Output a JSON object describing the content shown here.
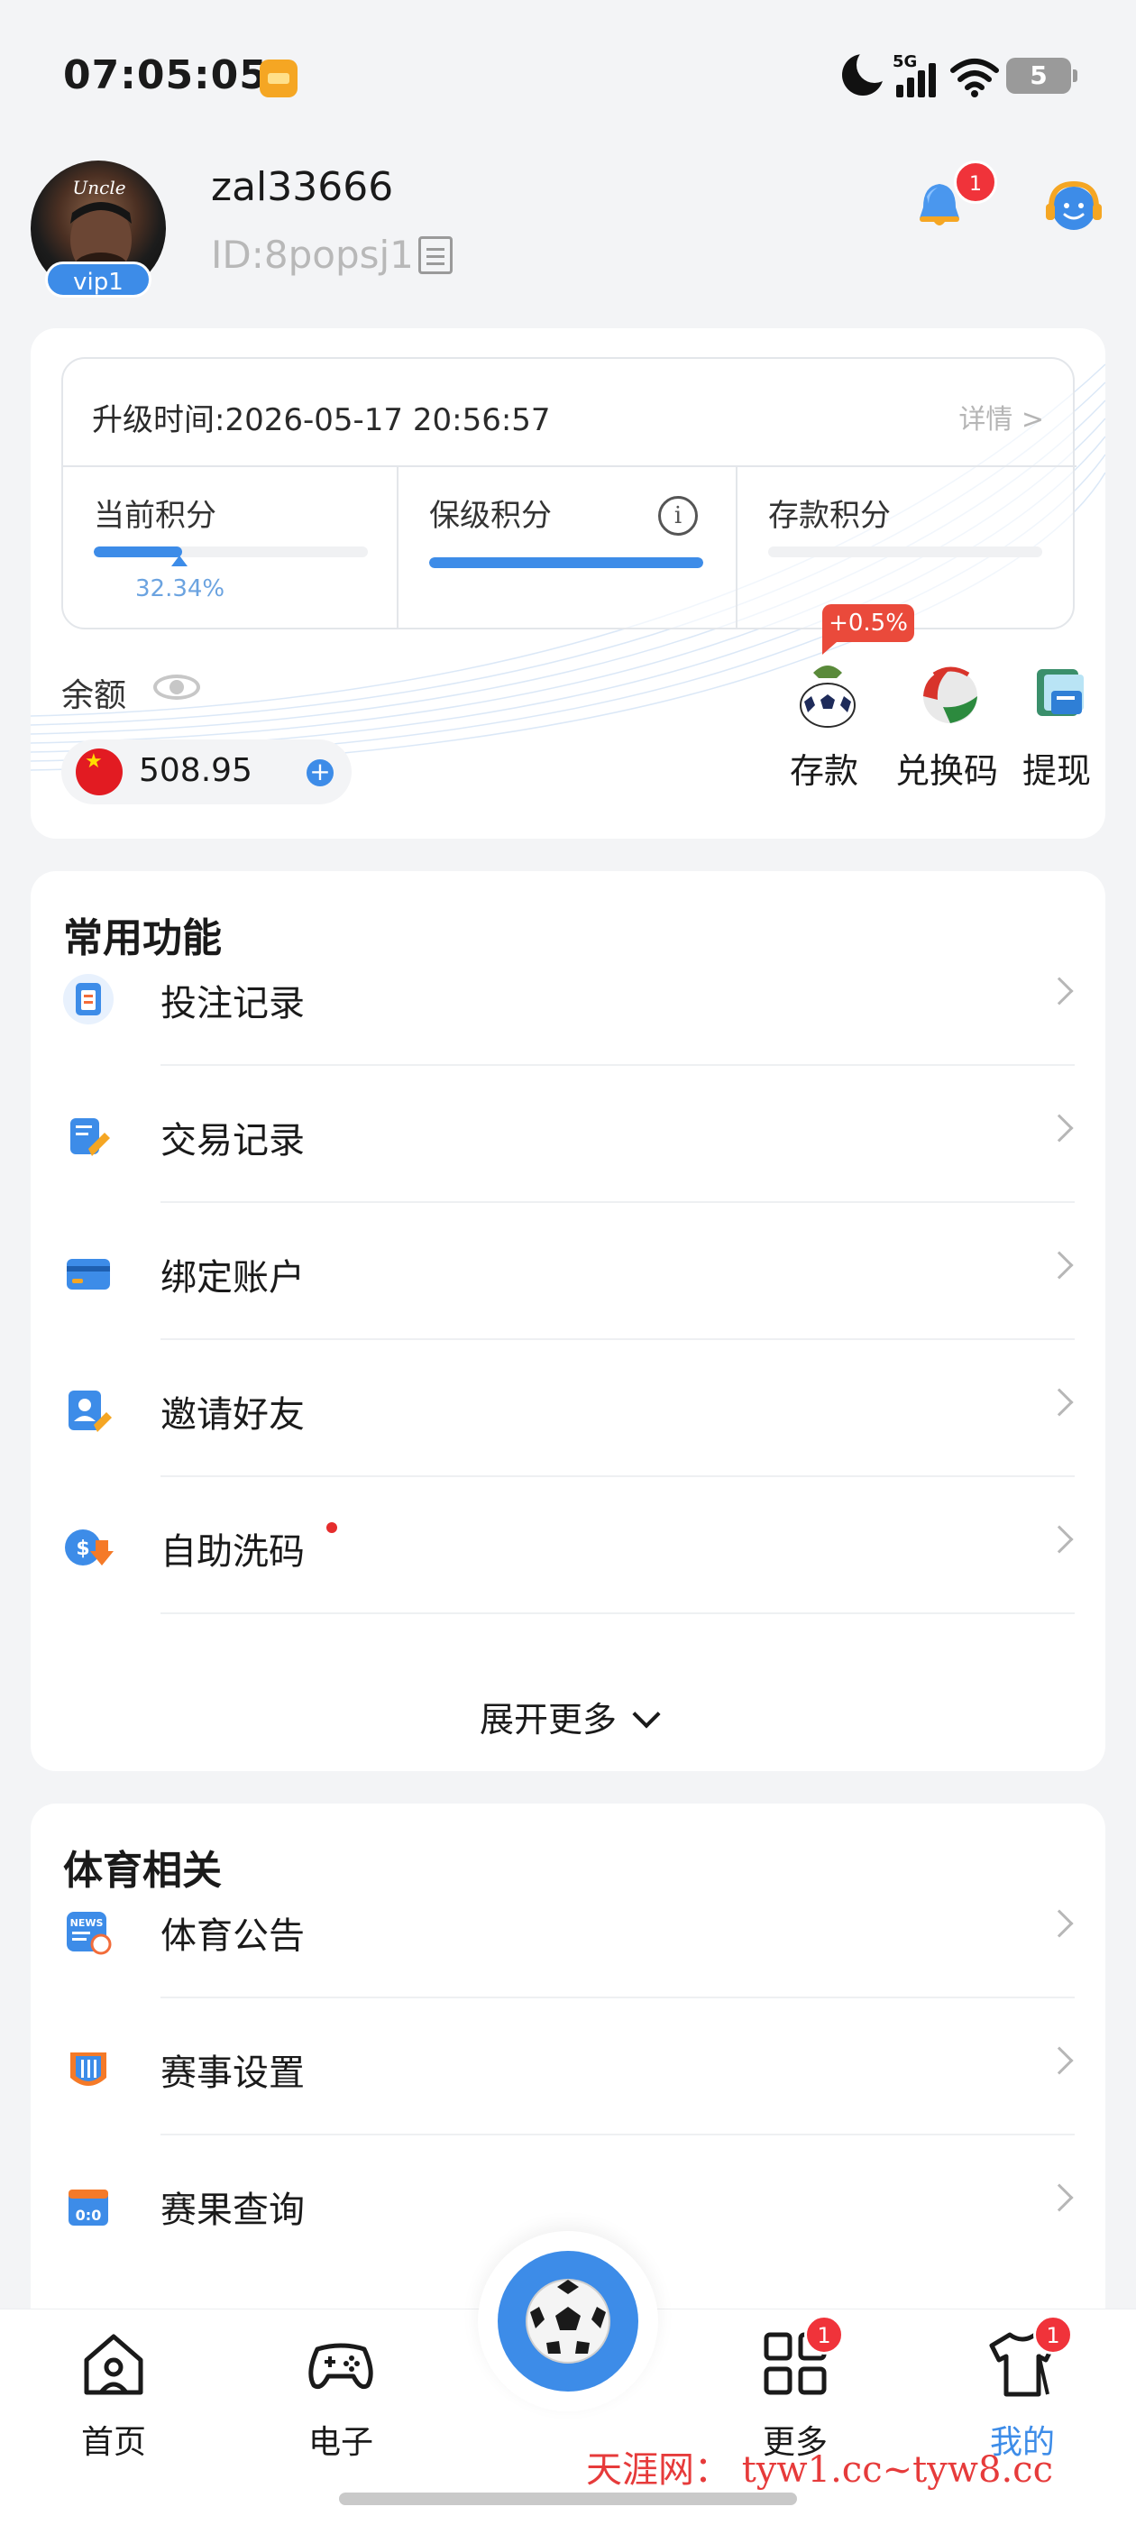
{
  "status_bar": {
    "time": "07:05:05",
    "network": "5G",
    "battery": "5"
  },
  "profile": {
    "avatar_caption": "Uncle",
    "vip_level": "vip1",
    "username": "zal33666",
    "user_id": "ID:8popsj1",
    "notification_count": "1"
  },
  "vip_card": {
    "upgrade_time": "升级时间:2026-05-17 20:56:57",
    "details_label": "详情 >",
    "current_points_label": "当前积分",
    "current_points_percent": "32.34%",
    "current_points_progress": 0.3234,
    "keep_points_label": "保级积分",
    "keep_points_progress": 1.0,
    "deposit_points_label": "存款积分",
    "deposit_points_progress": 0.0,
    "balance_label": "余额",
    "balance_value": "508.95",
    "bonus_tag": "+0.5%",
    "actions": [
      {
        "label": "存款",
        "icon": "deposit-icon"
      },
      {
        "label": "兑换码",
        "icon": "redeem-code-icon"
      },
      {
        "label": "提现",
        "icon": "withdraw-icon"
      }
    ]
  },
  "common": {
    "title": "常用功能",
    "items": [
      {
        "label": "投注记录",
        "icon": "bet-record-icon"
      },
      {
        "label": "交易记录",
        "icon": "transaction-record-icon"
      },
      {
        "label": "绑定账户",
        "icon": "bind-account-icon"
      },
      {
        "label": "邀请好友",
        "icon": "invite-friends-icon"
      },
      {
        "label": "自助洗码",
        "icon": "self-rebate-icon"
      }
    ],
    "expand_label": "展开更多"
  },
  "sports": {
    "title": "体育相关",
    "items": [
      {
        "label": "体育公告",
        "icon": "sports-news-icon"
      },
      {
        "label": "赛事设置",
        "icon": "match-settings-icon"
      },
      {
        "label": "赛果查询",
        "icon": "match-results-icon"
      }
    ]
  },
  "bottom_nav": {
    "items": [
      {
        "label": "首页",
        "icon": "home-icon"
      },
      {
        "label": "电子",
        "icon": "gamepad-icon"
      },
      {
        "label": "更多",
        "icon": "grid-icon",
        "badge": "1"
      },
      {
        "label": "我的",
        "icon": "jersey-icon",
        "badge": "1"
      }
    ]
  },
  "watermark": "天涯网： tyw1.cc~tyw8.cc",
  "colors": {
    "accent": "#3d8ce8",
    "badge": "#f0333a",
    "bonus": "#ea4a3b",
    "background": "#f3f4f6"
  }
}
